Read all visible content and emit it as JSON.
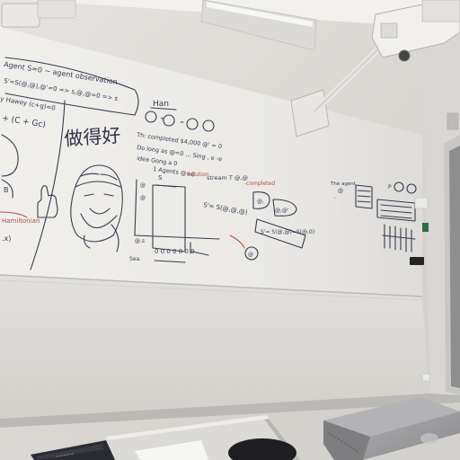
{
  "image": {
    "description_role": "photo",
    "colors": {
      "wall": "#e4e2de",
      "whiteboard": "#efeeea",
      "marker_ink": "#3a3a52",
      "red_marker": "#b24a4a",
      "floor_table": "#cfcdc9",
      "laptop": "#9a9a9c"
    }
  },
  "whiteboard": {
    "chinese_text": "做得好"
  },
  "icons": [
    "projector-icon",
    "laptop-icon",
    "book-icon",
    "cartoon-face-icon",
    "thumbs-up-icon"
  ]
}
